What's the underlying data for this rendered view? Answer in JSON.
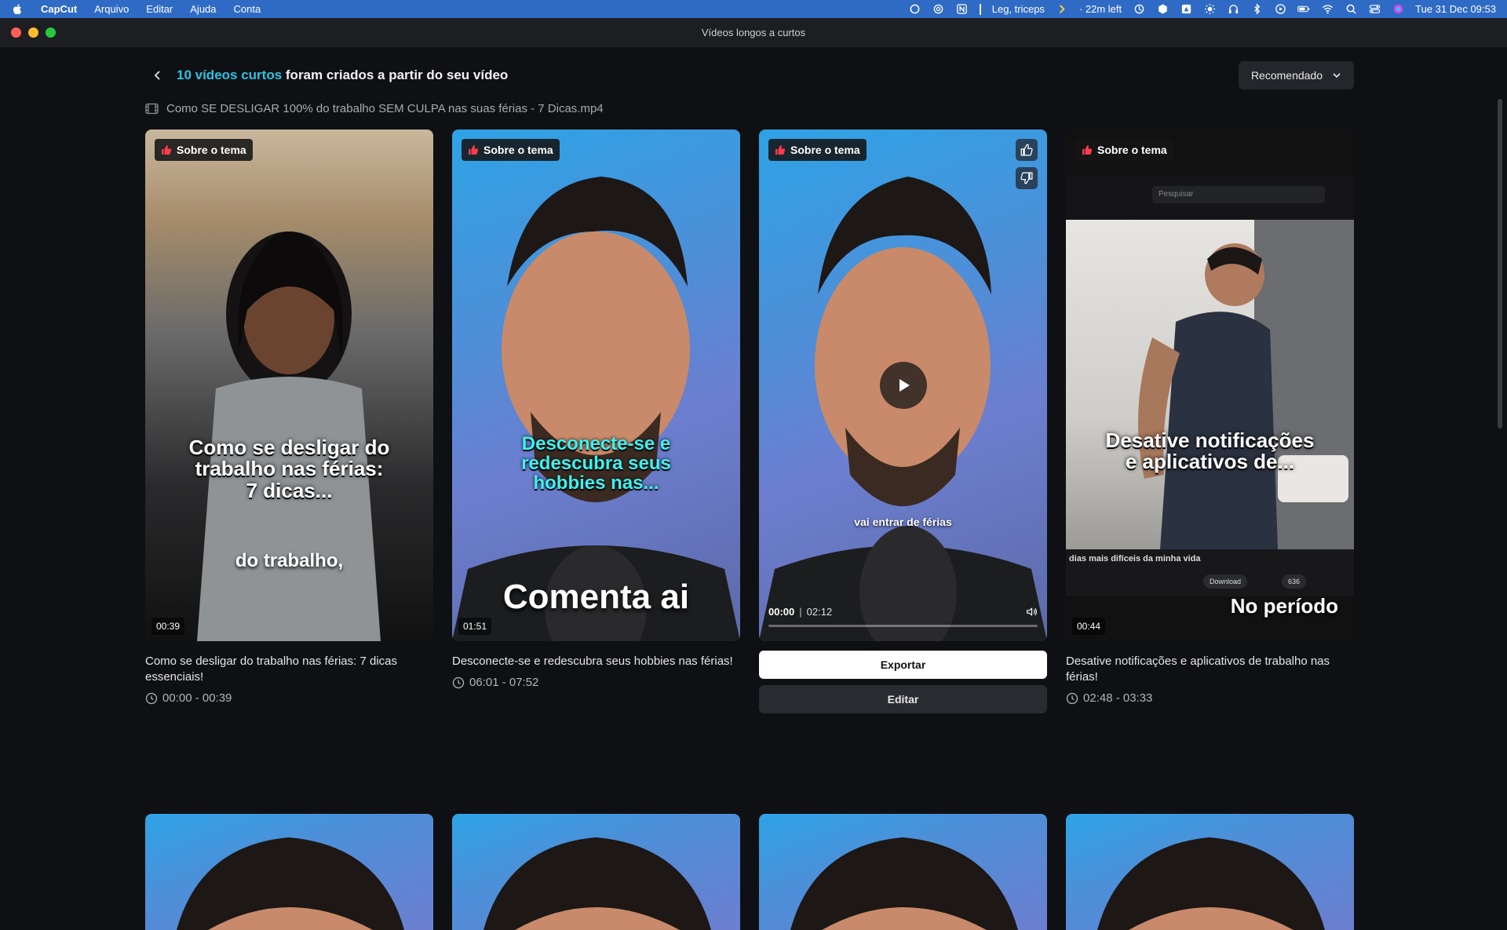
{
  "menubar": {
    "app": "CapCut",
    "menus": [
      "Arquivo",
      "Editar",
      "Ajuda",
      "Conta"
    ],
    "status_text": "Leg, triceps",
    "time_left": "· 22m left",
    "datetime": "Tue 31 Dec  09:53"
  },
  "window": {
    "title": "Vídeos longos a curtos"
  },
  "header": {
    "count_accent": "10 vídeos curtos",
    "headline_rest": " foram criados a partir do seu vídeo",
    "sort_label": "Recomendado"
  },
  "source": {
    "filename": "Como SE DESLIGAR 100% do trabalho SEM CULPA nas suas férias - 7 Dicas.mp4"
  },
  "cards": [
    {
      "tag": "Sobre o tema",
      "overlay_main": "Como se desligar do trabalho nas férias: 7 dicas...",
      "overlay_sub": "do trabalho,",
      "duration": "00:39",
      "caption": "Como se desligar do trabalho nas férias: 7 dicas essenciais!",
      "range": "00:00 - 00:39"
    },
    {
      "tag": "Sobre o tema",
      "overlay_main": "Desconecte-se e redescubra seus hobbies nas...",
      "overlay_sub": "Comenta ai",
      "duration": "01:51",
      "caption": "Desconecte-se e redescubra seus hobbies nas férias!",
      "range": "06:01 - 07:52"
    },
    {
      "tag": "Sobre o tema",
      "overlay_sub": "vai entrar de férias",
      "player_current": "00:00",
      "player_total": "02:12",
      "progress": 0,
      "export_label": "Exportar",
      "edit_label": "Editar"
    },
    {
      "tag": "Sobre o tema",
      "overlay_main": "Desative notificações e aplicativos de...",
      "overlay_sub": "No período",
      "screen_search": "Pesquisar",
      "screen_line": "dias mais difíceis da minha vida",
      "screen_download": "Download",
      "screen_likes": "636",
      "duration": "00:44",
      "caption": "Desative notificações e aplicativos de trabalho nas férias!",
      "range": "02:48 - 03:33"
    }
  ],
  "colors": {
    "accent": "#2bc4e4",
    "tag_icon": "#ff3b4e",
    "bg": "#0f1013"
  }
}
